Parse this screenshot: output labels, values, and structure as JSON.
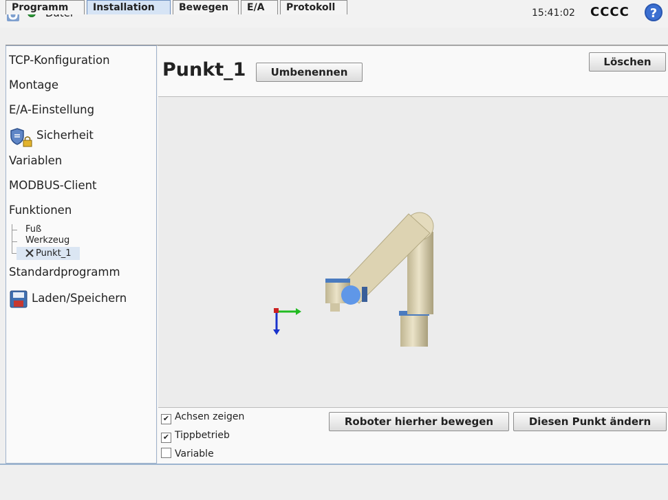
{
  "app": {
    "file_menu": "Datei",
    "clock": "15:41:02",
    "robot_name": "CCCC",
    "help_glyph": "?"
  },
  "tabs": [
    {
      "label": "Programm"
    },
    {
      "label": "Installation",
      "active": true
    },
    {
      "label": "Bewegen"
    },
    {
      "label": "E/A"
    },
    {
      "label": "Protokoll"
    }
  ],
  "sidebar": {
    "items": [
      {
        "label": "TCP-Konfiguration"
      },
      {
        "label": "Montage"
      },
      {
        "label": "E/A-Einstellung"
      },
      {
        "label": "Sicherheit",
        "icon": "shield-lock-icon"
      },
      {
        "label": "Variablen"
      },
      {
        "label": "MODBUS-Client"
      },
      {
        "label": "Funktionen"
      },
      {
        "label": "Standardprogramm"
      },
      {
        "label": "Laden/Speichern",
        "icon": "floppy-disk-icon"
      }
    ],
    "features": [
      "Fuß",
      "Werkzeug",
      "Punkt_1"
    ],
    "selected_feature": "Punkt_1"
  },
  "main": {
    "title": "Punkt_1",
    "rename_label": "Umbenennen",
    "delete_label": "Löschen",
    "move_here_label": "Roboter hierher bewegen",
    "change_point_label": "Diesen Punkt ändern",
    "checkboxes": [
      {
        "label": "Achsen zeigen",
        "checked": true
      },
      {
        "label": "Tippbetrieb",
        "checked": true
      },
      {
        "label": "Variable",
        "checked": false
      }
    ]
  },
  "colors": {
    "accent": "#3b6fd1",
    "status_ok": "#2e9a3a",
    "selection": "#dbe6f3",
    "robot_body": "#d2c7a4",
    "robot_ring": "#4a7bbf"
  }
}
